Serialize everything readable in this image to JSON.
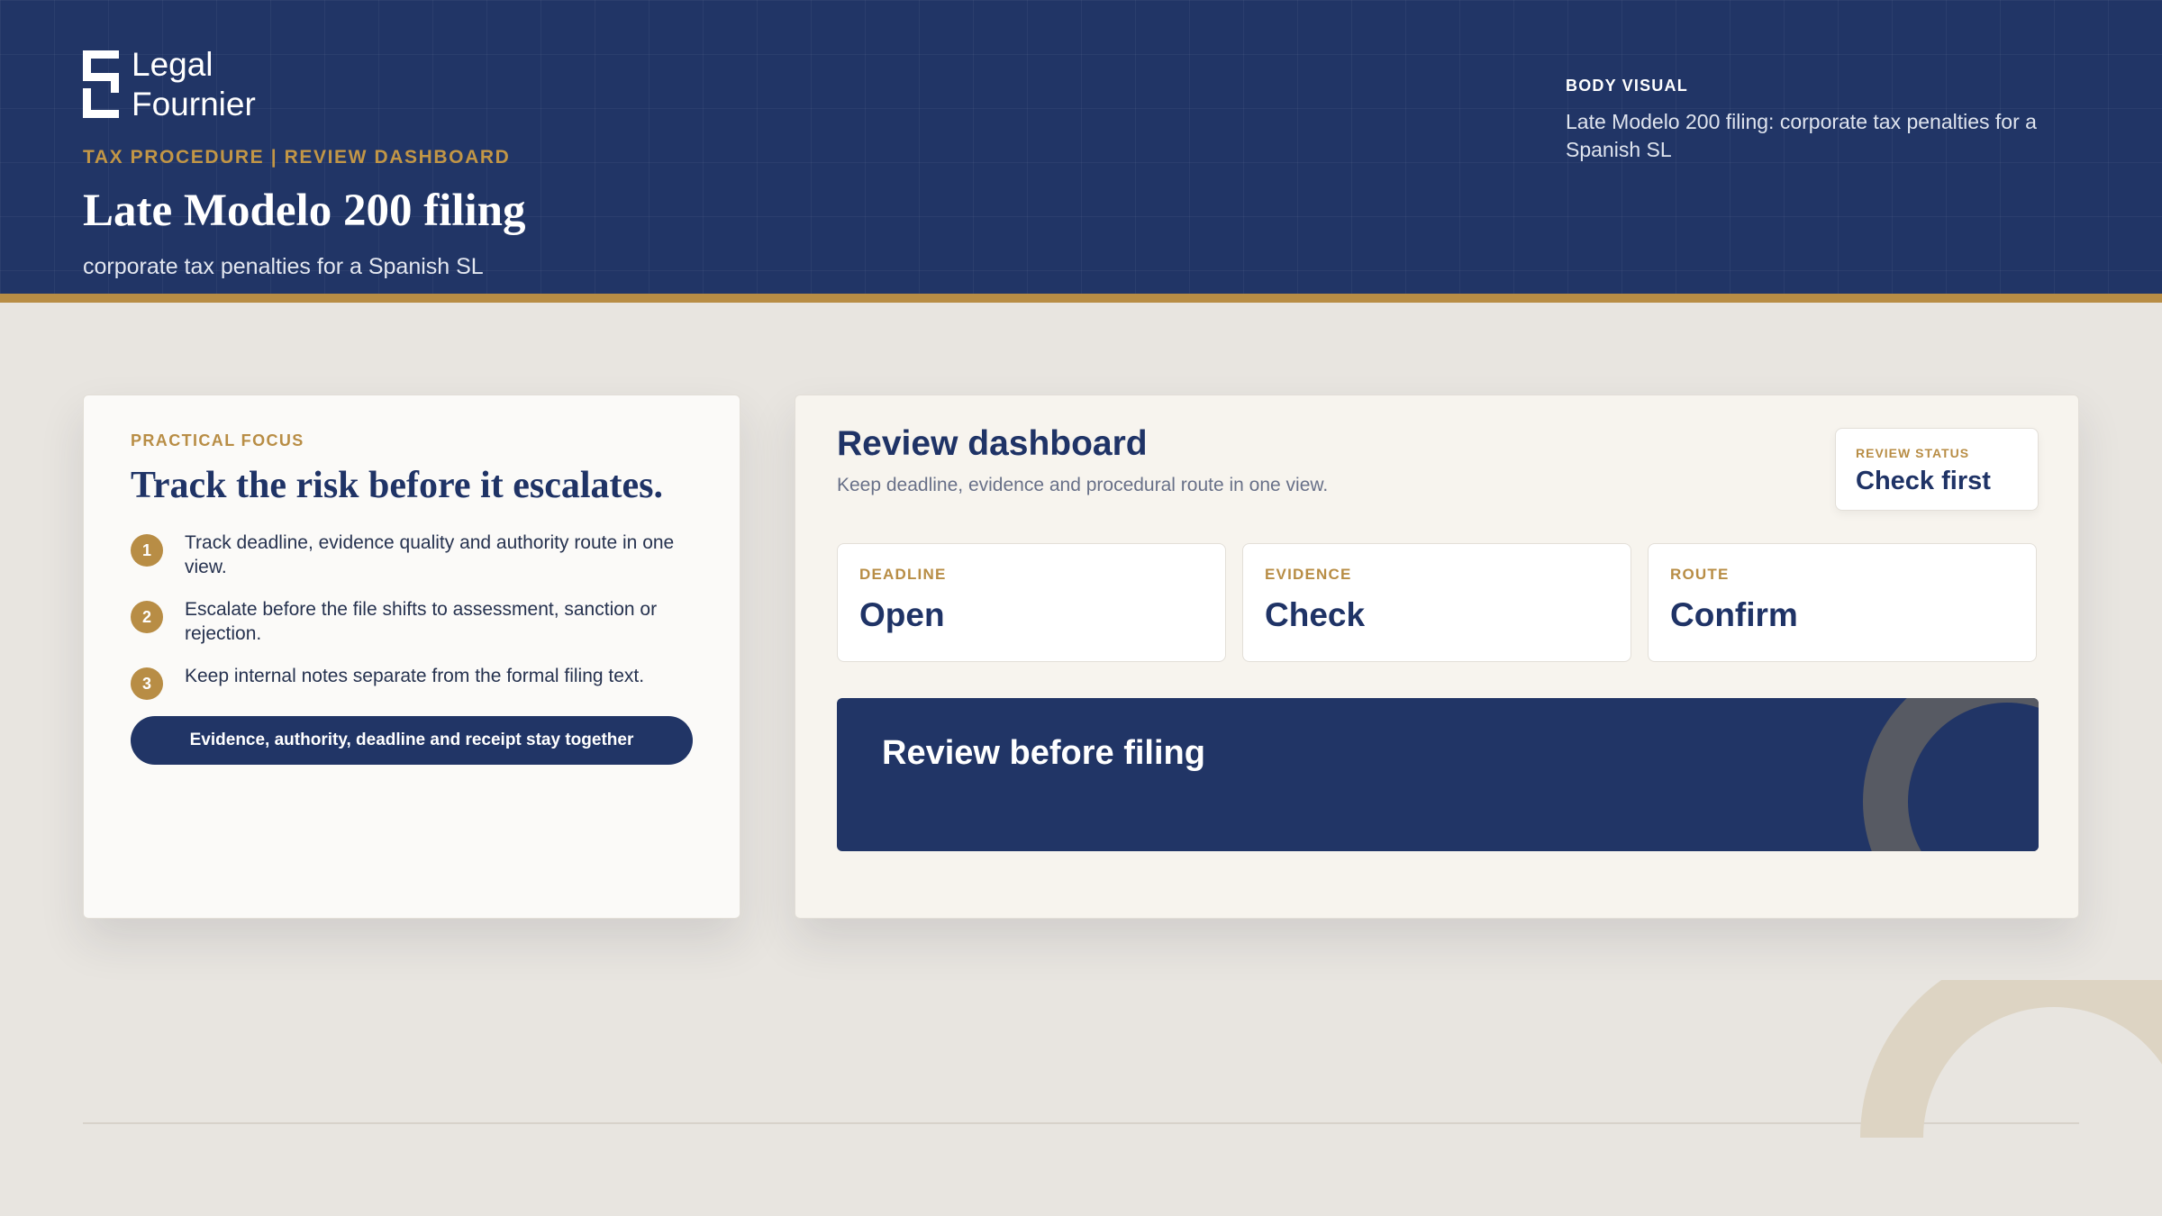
{
  "colors": {
    "navy": "#213566",
    "gold": "#b88d45",
    "page_bg": "#e8e5e0",
    "card_bg": "#fbfaf8"
  },
  "header": {
    "logo": {
      "icon": "brand-mark-icon",
      "line1": "Legal",
      "line2": "Fournier"
    },
    "eyebrow": "TAX PROCEDURE | REVIEW DASHBOARD",
    "title": "Late Modelo 200 filing",
    "subtitle": "corporate tax penalties for a Spanish SL",
    "visual_label": "BODY VISUAL",
    "visual_description": "Late Modelo 200 filing: corporate tax penalties for a Spanish SL"
  },
  "focus_card": {
    "label": "PRACTICAL FOCUS",
    "title": "Track the risk before it escalates.",
    "steps": [
      {
        "num": "1",
        "text": "Track deadline, evidence quality and authority route in one view."
      },
      {
        "num": "2",
        "text": "Escalate before the file shifts to assessment, sanction or rejection."
      },
      {
        "num": "3",
        "text": "Keep internal notes separate from the formal filing text."
      }
    ],
    "pill": "Evidence, authority, deadline and receipt stay together"
  },
  "dashboard": {
    "title": "Review dashboard",
    "subtitle": "Keep deadline, evidence and procedural route in one view.",
    "status": {
      "label": "REVIEW STATUS",
      "value": "Check first"
    },
    "metrics": [
      {
        "label": "DEADLINE",
        "value": "Open"
      },
      {
        "label": "EVIDENCE",
        "value": "Check"
      },
      {
        "label": "ROUTE",
        "value": "Confirm"
      }
    ],
    "banner": {
      "title": "Review before filing"
    }
  }
}
